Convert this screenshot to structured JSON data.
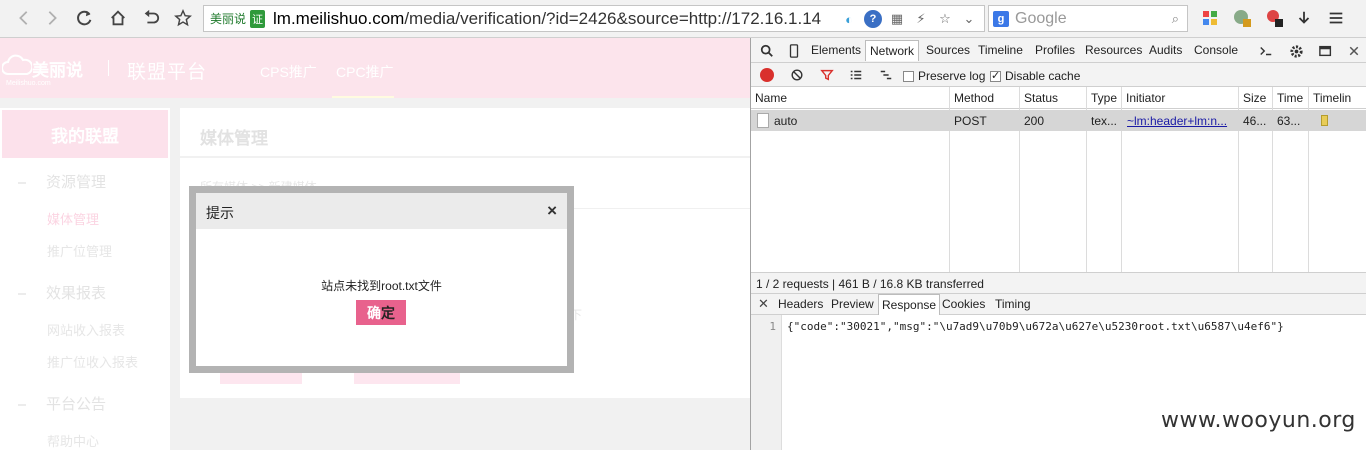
{
  "browser": {
    "site_badge": "美丽说",
    "cert_badge": "证",
    "url_host": "lm.meilishuo.com",
    "url_rest": "/media/verification/?id=2426&source=http://172.16.1.14",
    "search_placeholder": "Google",
    "search_engine_glyph": "g"
  },
  "page": {
    "logo_text": "美丽说",
    "logo_sub": "Meilishuo.com",
    "platform_title": "联盟平台",
    "nav": [
      "CPS推广",
      "CPC推广"
    ],
    "sidebar_title": "我的联盟",
    "sidebar_groups": [
      {
        "label": "资源管理",
        "items": [
          "媒体管理",
          "推广位管理"
        ]
      },
      {
        "label": "效果报表",
        "items": [
          "网站收入报表",
          "推广位收入报表"
        ]
      },
      {
        "label": "平台公告",
        "items": [
          "帮助中心"
        ]
      }
    ],
    "content_title": "媒体管理",
    "breadcrumb": "所有媒体 >> 新建媒体",
    "ghost_text": "下"
  },
  "dialog": {
    "title": "提示",
    "close": "×",
    "message": "站点未找到root.txt文件",
    "ok_first": "确",
    "ok_rest": "定"
  },
  "devtools": {
    "tabs": [
      "Elements",
      "Network",
      "Sources",
      "Timeline",
      "Profiles",
      "Resources",
      "Audits",
      "Console"
    ],
    "active_tab": "Network",
    "preserve_log": "Preserve log",
    "preserve_log_checked": false,
    "disable_cache": "Disable cache",
    "disable_cache_checked": true,
    "columns": [
      "Name",
      "Method",
      "Status",
      "Type",
      "Initiator",
      "Size",
      "Time",
      "Timelin"
    ],
    "row": {
      "name": "auto",
      "method": "POST",
      "status": "200",
      "type": "tex...",
      "initiator": "~lm:header+lm:n...",
      "size": "46...",
      "time": "63..."
    },
    "summary": "1 / 2 requests | 461 B / 16.8 KB transferred",
    "detail_tabs": [
      "Headers",
      "Preview",
      "Response",
      "Cookies",
      "Timing"
    ],
    "active_detail_tab": "Response",
    "line_number": "1",
    "response_text": "{\"code\":\"30021\",\"msg\":\"\\u7ad9\\u70b9\\u672a\\u627e\\u5230root.txt\\u6587\\u4ef6\"}"
  },
  "watermark": "www.wooyun.org"
}
